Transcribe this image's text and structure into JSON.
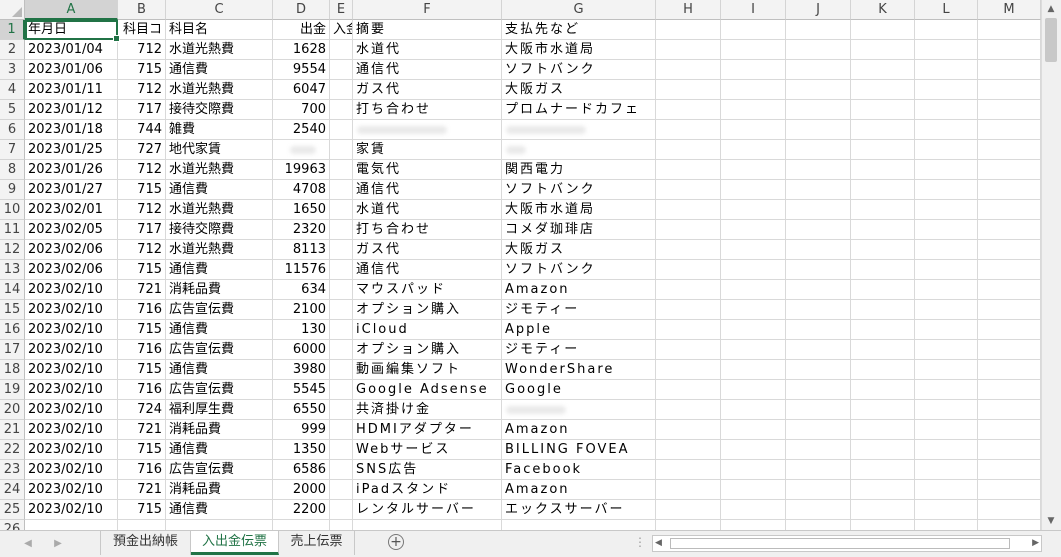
{
  "columns": [
    "A",
    "B",
    "C",
    "D",
    "E",
    "F",
    "G",
    "H",
    "I",
    "J",
    "K",
    "L",
    "M"
  ],
  "header_row": [
    "年月日",
    "科目コ",
    "科目名",
    "出金",
    "入金",
    "摘要",
    "支払先など"
  ],
  "rows": [
    [
      "2023/01/04",
      "712",
      "水道光熱費",
      "1628",
      "",
      "水道代",
      "大阪市水道局"
    ],
    [
      "2023/01/06",
      "715",
      "通信費",
      "9554",
      "",
      "通信代",
      "ソフトバンク"
    ],
    [
      "2023/01/11",
      "712",
      "水道光熱費",
      "6047",
      "",
      "ガス代",
      "大阪ガス"
    ],
    [
      "2023/01/12",
      "717",
      "接待交際費",
      "700",
      "",
      "打ち合わせ",
      "プロムナードカフェ"
    ],
    [
      "2023/01/18",
      "744",
      "雑費",
      "2540",
      "",
      "",
      ""
    ],
    [
      "2023/01/25",
      "727",
      "地代家賃",
      "",
      "",
      "家賃",
      ""
    ],
    [
      "2023/01/26",
      "712",
      "水道光熱費",
      "19963",
      "",
      "電気代",
      "関西電力"
    ],
    [
      "2023/01/27",
      "715",
      "通信費",
      "4708",
      "",
      "通信代",
      "ソフトバンク"
    ],
    [
      "2023/02/01",
      "712",
      "水道光熱費",
      "1650",
      "",
      "水道代",
      "大阪市水道局"
    ],
    [
      "2023/02/05",
      "717",
      "接待交際費",
      "2320",
      "",
      "打ち合わせ",
      "コメダ珈琲店"
    ],
    [
      "2023/02/06",
      "712",
      "水道光熱費",
      "8113",
      "",
      "ガス代",
      "大阪ガス"
    ],
    [
      "2023/02/06",
      "715",
      "通信費",
      "11576",
      "",
      "通信代",
      "ソフトバンク"
    ],
    [
      "2023/02/10",
      "721",
      "消耗品費",
      "634",
      "",
      "マウスパッド",
      "Amazon"
    ],
    [
      "2023/02/10",
      "716",
      "広告宣伝費",
      "2100",
      "",
      "オプション購入",
      "ジモティー"
    ],
    [
      "2023/02/10",
      "715",
      "通信費",
      "130",
      "",
      "iCloud",
      "Apple"
    ],
    [
      "2023/02/10",
      "716",
      "広告宣伝費",
      "6000",
      "",
      "オプション購入",
      "ジモティー"
    ],
    [
      "2023/02/10",
      "715",
      "通信費",
      "3980",
      "",
      "動画編集ソフト",
      "WonderShare"
    ],
    [
      "2023/02/10",
      "716",
      "広告宣伝費",
      "5545",
      "",
      "Google Adsense",
      "Google"
    ],
    [
      "2023/02/10",
      "724",
      "福利厚生費",
      "6550",
      "",
      "共済掛け金",
      ""
    ],
    [
      "2023/02/10",
      "721",
      "消耗品費",
      "999",
      "",
      "HDMIアダプター",
      "Amazon"
    ],
    [
      "2023/02/10",
      "715",
      "通信費",
      "1350",
      "",
      "Webサービス",
      "BILLING FOVEA"
    ],
    [
      "2023/02/10",
      "716",
      "広告宣伝費",
      "6586",
      "",
      "SNS広告",
      "Facebook"
    ],
    [
      "2023/02/10",
      "721",
      "消耗品費",
      "2000",
      "",
      "iPadスタンド",
      "Amazon"
    ],
    [
      "2023/02/10",
      "715",
      "通信費",
      "2200",
      "",
      "レンタルサーバー",
      "エックスサーバー"
    ]
  ],
  "sheet_tabs": [
    "預金出納帳",
    "入出金伝票",
    "売上伝票"
  ],
  "active_tab": "入出金伝票",
  "active_cell": "A1",
  "accent_color": "#217346"
}
